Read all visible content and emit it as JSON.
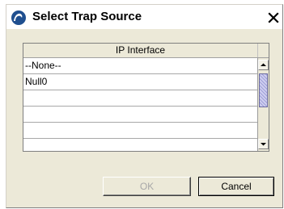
{
  "window": {
    "title": "Select Trap Source",
    "icon": "app-logo-icon",
    "close_icon": "close-icon"
  },
  "table": {
    "column_header": "IP Interface",
    "rows": [
      "--None--",
      "Null0",
      "",
      "",
      ""
    ]
  },
  "scrollbar": {
    "up_icon": "arrow-up-icon",
    "down_icon": "arrow-down-icon"
  },
  "buttons": {
    "ok_label": "OK",
    "ok_enabled": false,
    "cancel_label": "Cancel"
  },
  "colors": {
    "dialog_background": "#ece9d8",
    "thumb": "#b9b9e4",
    "disabled_text": "#a8a8a8"
  }
}
